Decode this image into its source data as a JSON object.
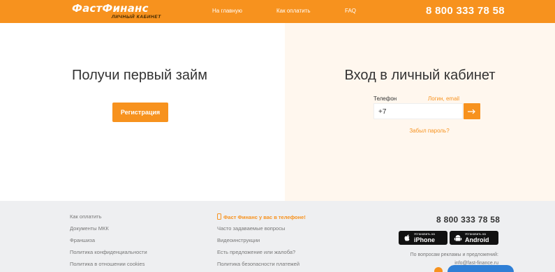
{
  "header": {
    "logo_main": "ФастФинанс",
    "logo_sub": "ЛИЧНЫЙ КАБИНЕТ",
    "nav": [
      {
        "label": "На главную"
      },
      {
        "label": "Как оплатить"
      },
      {
        "label": "FAQ"
      }
    ],
    "phone": "8 800 333 78 58"
  },
  "left": {
    "title": "Получи первый займ",
    "register_label": "Регистрация"
  },
  "login": {
    "title": "Вход в личный кабинет",
    "tab_phone": "Телефон",
    "tab_login": "Логин, email",
    "phone_value": "+7",
    "forgot": "Забыл пароль?"
  },
  "footer": {
    "col1": [
      {
        "label": "Как оплатить"
      },
      {
        "label": "Документы МКК"
      },
      {
        "label": "Франшиза"
      },
      {
        "label": "Политика конфиденциальности"
      },
      {
        "label": "Политика в отношении cookies"
      }
    ],
    "mobile_promo": "Фаст Финанс у вас в телефоне!",
    "col2": [
      {
        "label": "Часто задаваемые вопросы"
      },
      {
        "label": "Видеоинструкции"
      },
      {
        "label": "Есть предложение или жалоба?"
      },
      {
        "label": "Политика безопасности платежей"
      }
    ],
    "phone": "8 800 333 78 58",
    "apps": [
      {
        "small": "Установить на",
        "big": "iPhone",
        "icon": "apple-icon"
      },
      {
        "small": "Установить на",
        "big": "Android",
        "icon": "android-icon"
      }
    ],
    "ads_text": "По вопросам рекламы и предложений:",
    "ads_email": "info@fast-finance.ru"
  },
  "colors": {
    "accent": "#f7921e",
    "panel_bg": "#fff7ee",
    "footer_bg": "#eeeff1",
    "chat": "#2f7fd6"
  }
}
